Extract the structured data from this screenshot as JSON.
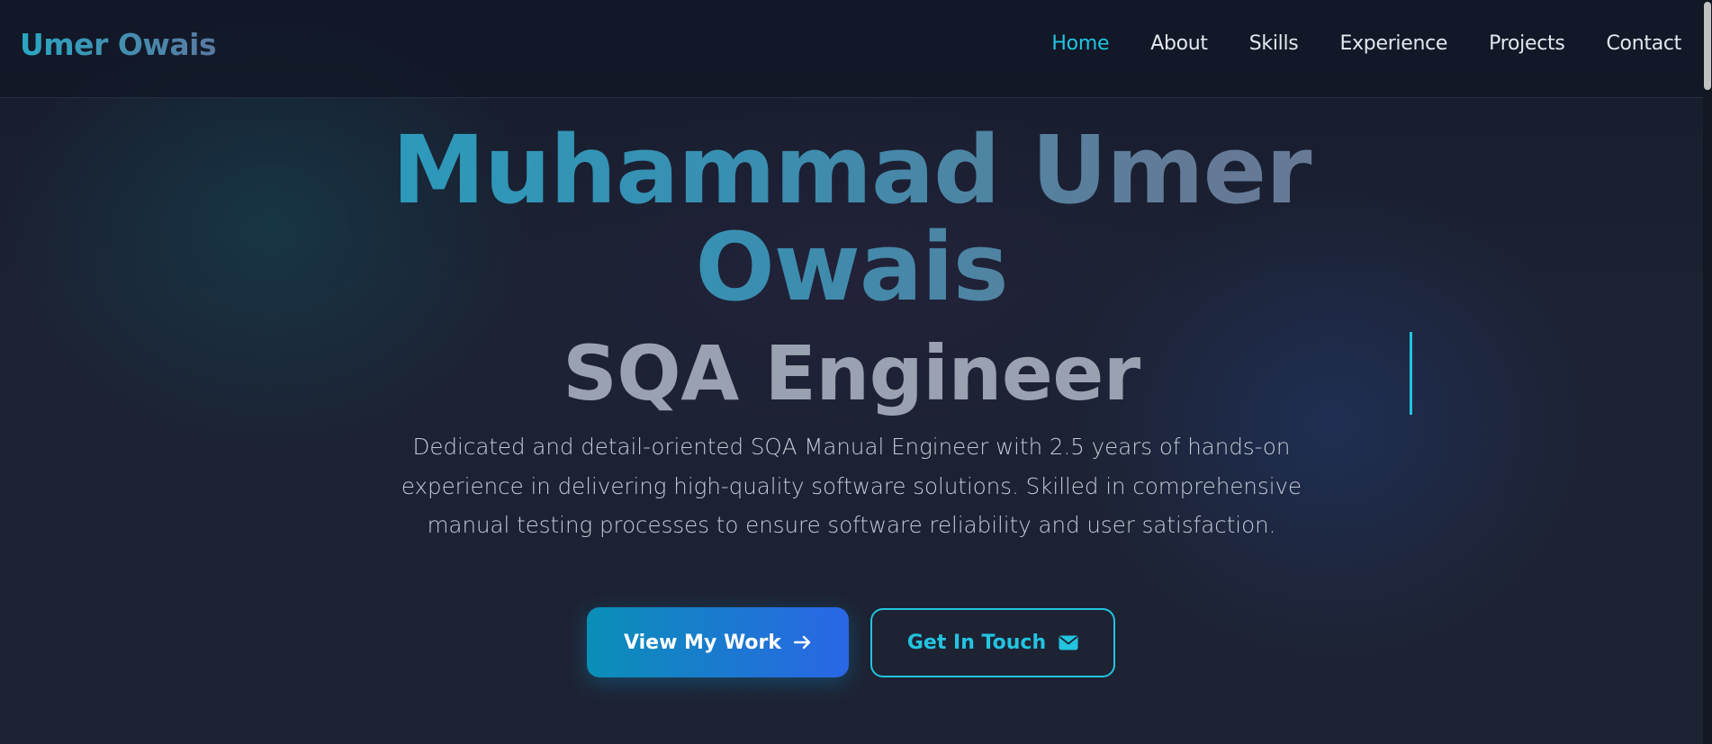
{
  "nav": {
    "brand": "Umer Owais",
    "links": [
      {
        "label": "Home",
        "active": true
      },
      {
        "label": "About"
      },
      {
        "label": "Skills"
      },
      {
        "label": "Experience"
      },
      {
        "label": "Projects"
      },
      {
        "label": "Contact"
      }
    ]
  },
  "hero": {
    "name_line1": "Muhammad Umer",
    "name_line2": "Owais",
    "role": "SQA Engineer",
    "description": "Dedicated and detail-oriented SQA Manual Engineer with 2.5 years of hands-on experience in delivering high-quality software solutions. Skilled in comprehensive manual testing processes to ensure software reliability and user satisfaction.",
    "primary_button": {
      "label": "View My Work",
      "icon": "arrow-right-icon"
    },
    "secondary_button": {
      "label": "Get In Touch",
      "icon": "envelope-icon"
    }
  },
  "colors": {
    "accent": "#22c4e0",
    "primary_gradient_start": "#0a8fb7",
    "primary_gradient_end": "#2a66e6",
    "background": "#1b2232"
  }
}
